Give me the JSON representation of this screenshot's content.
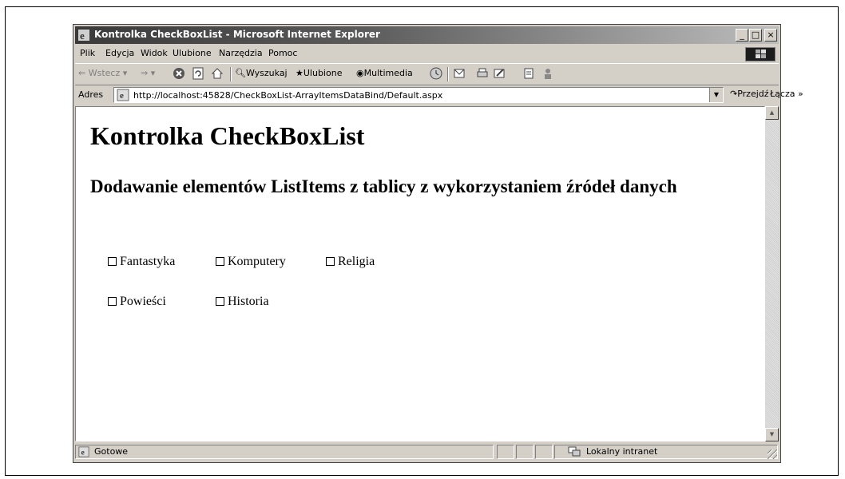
{
  "window": {
    "title": "Kontrolka CheckBoxList - Microsoft Internet Explorer",
    "controls": {
      "minimize": "_",
      "maximize": "□",
      "close": "×"
    }
  },
  "menu": [
    "Plik",
    "Edycja",
    "Widok",
    "Ulubione",
    "Narzędzia",
    "Pomoc"
  ],
  "toolbar": {
    "back": "Wstecz",
    "search": "Wyszukaj",
    "favorites": "Ulubione",
    "media": "Multimedia"
  },
  "address": {
    "label": "Adres",
    "url": "http://localhost:45828/CheckBoxList-ArrayItemsDataBind/Default.aspx",
    "go": "Przejdź",
    "links": "Łącza »"
  },
  "page": {
    "heading": "Kontrolka CheckBoxList",
    "subheading": "Dodawanie elementów ListItems z tablicy z wykorzystaniem źródeł danych",
    "checkboxes": [
      {
        "label": "Fantastyka",
        "checked": false
      },
      {
        "label": "Komputery",
        "checked": false
      },
      {
        "label": "Religia",
        "checked": false
      },
      {
        "label": "Powieści",
        "checked": false
      },
      {
        "label": "Historia",
        "checked": false
      }
    ]
  },
  "status": {
    "text": "Gotowe",
    "zone": "Lokalny intranet"
  }
}
